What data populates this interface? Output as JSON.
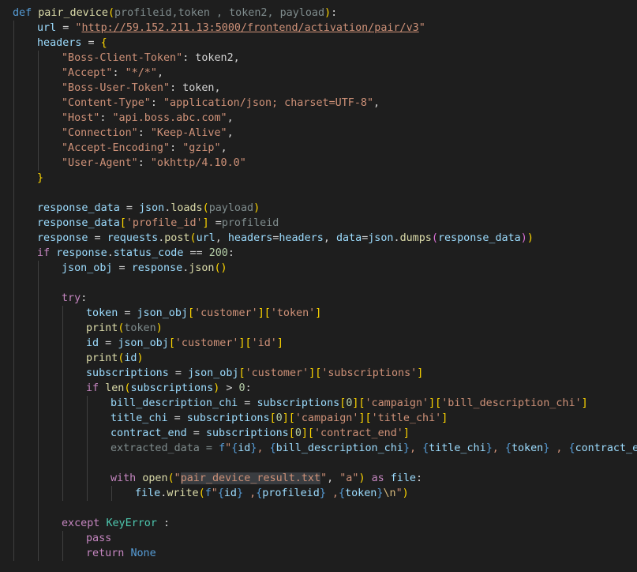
{
  "editor": {
    "language": "python",
    "theme": "dark",
    "colors": {
      "background": "#1e1e1e",
      "keyword": "#569cd6",
      "control": "#c586c0",
      "function": "#dcdcaa",
      "variable": "#9cdcfe",
      "string": "#ce9178",
      "number": "#b5cea8",
      "class": "#4ec9b0",
      "indent_guide": "#404040"
    },
    "lines": [
      {
        "indent": 0,
        "tokens": [
          {
            "t": "def",
            "c": "kw"
          },
          {
            "t": " "
          },
          {
            "t": "pair_device",
            "c": "fn"
          },
          {
            "t": "(",
            "c": "brk"
          },
          {
            "t": "profileid,token , token2, payload",
            "c": "dim"
          },
          {
            "t": ")",
            "c": "brk"
          },
          {
            "t": ":"
          }
        ]
      },
      {
        "indent": 1,
        "tokens": [
          {
            "t": "url",
            "c": "var"
          },
          {
            "t": " = "
          },
          {
            "t": "\"",
            "c": "str"
          },
          {
            "t": "http://59.152.211.13:5000/frontend/activation/pair/v3",
            "c": "url"
          },
          {
            "t": "\"",
            "c": "str"
          }
        ]
      },
      {
        "indent": 1,
        "tokens": [
          {
            "t": "headers",
            "c": "var"
          },
          {
            "t": " = "
          },
          {
            "t": "{",
            "c": "brk"
          }
        ]
      },
      {
        "indent": 2,
        "tokens": [
          {
            "t": "\"Boss-Client-Token\"",
            "c": "str"
          },
          {
            "t": ": token2,"
          }
        ]
      },
      {
        "indent": 2,
        "tokens": [
          {
            "t": "\"Accept\"",
            "c": "str"
          },
          {
            "t": ": "
          },
          {
            "t": "\"*/*\"",
            "c": "str"
          },
          {
            "t": ","
          }
        ]
      },
      {
        "indent": 2,
        "tokens": [
          {
            "t": "\"Boss-User-Token\"",
            "c": "str"
          },
          {
            "t": ": token,"
          }
        ]
      },
      {
        "indent": 2,
        "tokens": [
          {
            "t": "\"Content-Type\"",
            "c": "str"
          },
          {
            "t": ": "
          },
          {
            "t": "\"application/json; charset=UTF-8\"",
            "c": "str"
          },
          {
            "t": ","
          }
        ]
      },
      {
        "indent": 2,
        "tokens": [
          {
            "t": "\"Host\"",
            "c": "str"
          },
          {
            "t": ": "
          },
          {
            "t": "\"api.boss.abc.com\"",
            "c": "str"
          },
          {
            "t": ","
          }
        ]
      },
      {
        "indent": 2,
        "tokens": [
          {
            "t": "\"Connection\"",
            "c": "str"
          },
          {
            "t": ": "
          },
          {
            "t": "\"Keep-Alive\"",
            "c": "str"
          },
          {
            "t": ","
          }
        ]
      },
      {
        "indent": 2,
        "tokens": [
          {
            "t": "\"Accept-Encoding\"",
            "c": "str"
          },
          {
            "t": ": "
          },
          {
            "t": "\"gzip\"",
            "c": "str"
          },
          {
            "t": ","
          }
        ]
      },
      {
        "indent": 2,
        "tokens": [
          {
            "t": "\"User-Agent\"",
            "c": "str"
          },
          {
            "t": ": "
          },
          {
            "t": "\"okhttp/4.10.0\"",
            "c": "str"
          }
        ]
      },
      {
        "indent": 1,
        "tokens": [
          {
            "t": "}",
            "c": "brk"
          }
        ]
      },
      {
        "indent": 0,
        "tokens": []
      },
      {
        "indent": 1,
        "tokens": [
          {
            "t": "response_data",
            "c": "var"
          },
          {
            "t": " = "
          },
          {
            "t": "json",
            "c": "var"
          },
          {
            "t": "."
          },
          {
            "t": "loads",
            "c": "fn"
          },
          {
            "t": "(",
            "c": "brk"
          },
          {
            "t": "payload",
            "c": "dim"
          },
          {
            "t": ")",
            "c": "brk"
          }
        ]
      },
      {
        "indent": 1,
        "tokens": [
          {
            "t": "response_data",
            "c": "var"
          },
          {
            "t": "[",
            "c": "brk"
          },
          {
            "t": "'profile_id'",
            "c": "str"
          },
          {
            "t": "]",
            "c": "brk"
          },
          {
            "t": " ="
          },
          {
            "t": "profileid",
            "c": "dim"
          }
        ]
      },
      {
        "indent": 1,
        "tokens": [
          {
            "t": "response",
            "c": "var"
          },
          {
            "t": " = "
          },
          {
            "t": "requests",
            "c": "var"
          },
          {
            "t": "."
          },
          {
            "t": "post",
            "c": "fn"
          },
          {
            "t": "(",
            "c": "brk"
          },
          {
            "t": "url",
            "c": "var"
          },
          {
            "t": ", "
          },
          {
            "t": "headers",
            "c": "var"
          },
          {
            "t": "="
          },
          {
            "t": "headers",
            "c": "var"
          },
          {
            "t": ", "
          },
          {
            "t": "data",
            "c": "var"
          },
          {
            "t": "="
          },
          {
            "t": "json",
            "c": "var"
          },
          {
            "t": "."
          },
          {
            "t": "dumps",
            "c": "fn"
          },
          {
            "t": "(",
            "c": "par"
          },
          {
            "t": "response_data",
            "c": "var"
          },
          {
            "t": ")",
            "c": "par"
          },
          {
            "t": ")",
            "c": "brk"
          }
        ]
      },
      {
        "indent": 1,
        "tokens": [
          {
            "t": "if",
            "c": "ctl"
          },
          {
            "t": " "
          },
          {
            "t": "response",
            "c": "var"
          },
          {
            "t": "."
          },
          {
            "t": "status_code",
            "c": "var"
          },
          {
            "t": " == "
          },
          {
            "t": "200",
            "c": "num"
          },
          {
            "t": ":"
          }
        ]
      },
      {
        "indent": 2,
        "tokens": [
          {
            "t": "json_obj",
            "c": "var"
          },
          {
            "t": " = "
          },
          {
            "t": "response",
            "c": "var"
          },
          {
            "t": "."
          },
          {
            "t": "json",
            "c": "fn"
          },
          {
            "t": "()",
            "c": "brk"
          }
        ]
      },
      {
        "indent": 0,
        "tokens": []
      },
      {
        "indent": 2,
        "tokens": [
          {
            "t": "try",
            "c": "ctl"
          },
          {
            "t": ":"
          }
        ]
      },
      {
        "indent": 3,
        "tokens": [
          {
            "t": "token",
            "c": "var"
          },
          {
            "t": " = "
          },
          {
            "t": "json_obj",
            "c": "var"
          },
          {
            "t": "[",
            "c": "brk"
          },
          {
            "t": "'customer'",
            "c": "str"
          },
          {
            "t": "][",
            "c": "brk"
          },
          {
            "t": "'token'",
            "c": "str"
          },
          {
            "t": "]",
            "c": "brk"
          }
        ]
      },
      {
        "indent": 3,
        "tokens": [
          {
            "t": "print",
            "c": "fn"
          },
          {
            "t": "(",
            "c": "brk"
          },
          {
            "t": "token",
            "c": "dim"
          },
          {
            "t": ")",
            "c": "brk"
          }
        ]
      },
      {
        "indent": 3,
        "tokens": [
          {
            "t": "id",
            "c": "var"
          },
          {
            "t": " = "
          },
          {
            "t": "json_obj",
            "c": "var"
          },
          {
            "t": "[",
            "c": "brk"
          },
          {
            "t": "'customer'",
            "c": "str"
          },
          {
            "t": "][",
            "c": "brk"
          },
          {
            "t": "'id'",
            "c": "str"
          },
          {
            "t": "]",
            "c": "brk"
          }
        ]
      },
      {
        "indent": 3,
        "tokens": [
          {
            "t": "print",
            "c": "fn"
          },
          {
            "t": "(",
            "c": "brk"
          },
          {
            "t": "id",
            "c": "var"
          },
          {
            "t": ")",
            "c": "brk"
          }
        ]
      },
      {
        "indent": 3,
        "tokens": [
          {
            "t": "subscriptions",
            "c": "var"
          },
          {
            "t": " = "
          },
          {
            "t": "json_obj",
            "c": "var"
          },
          {
            "t": "[",
            "c": "brk"
          },
          {
            "t": "'customer'",
            "c": "str"
          },
          {
            "t": "][",
            "c": "brk"
          },
          {
            "t": "'subscriptions'",
            "c": "str"
          },
          {
            "t": "]",
            "c": "brk"
          }
        ]
      },
      {
        "indent": 3,
        "tokens": [
          {
            "t": "if",
            "c": "ctl"
          },
          {
            "t": " "
          },
          {
            "t": "len",
            "c": "fn"
          },
          {
            "t": "(",
            "c": "brk"
          },
          {
            "t": "subscriptions",
            "c": "var"
          },
          {
            "t": ")",
            "c": "brk"
          },
          {
            "t": " > "
          },
          {
            "t": "0",
            "c": "num"
          },
          {
            "t": ":"
          }
        ]
      },
      {
        "indent": 4,
        "tokens": [
          {
            "t": "bill_description_chi",
            "c": "var"
          },
          {
            "t": " = "
          },
          {
            "t": "subscriptions",
            "c": "var"
          },
          {
            "t": "[",
            "c": "brk"
          },
          {
            "t": "0",
            "c": "num"
          },
          {
            "t": "][",
            "c": "brk"
          },
          {
            "t": "'campaign'",
            "c": "str"
          },
          {
            "t": "][",
            "c": "brk"
          },
          {
            "t": "'bill_description_chi'",
            "c": "str"
          },
          {
            "t": "]",
            "c": "brk"
          }
        ]
      },
      {
        "indent": 4,
        "tokens": [
          {
            "t": "title_chi",
            "c": "var"
          },
          {
            "t": " = "
          },
          {
            "t": "subscriptions",
            "c": "var"
          },
          {
            "t": "[",
            "c": "brk"
          },
          {
            "t": "0",
            "c": "num"
          },
          {
            "t": "][",
            "c": "brk"
          },
          {
            "t": "'campaign'",
            "c": "str"
          },
          {
            "t": "][",
            "c": "brk"
          },
          {
            "t": "'title_chi'",
            "c": "str"
          },
          {
            "t": "]",
            "c": "brk"
          }
        ]
      },
      {
        "indent": 4,
        "tokens": [
          {
            "t": "contract_end",
            "c": "var"
          },
          {
            "t": " = "
          },
          {
            "t": "subscriptions",
            "c": "var"
          },
          {
            "t": "[",
            "c": "brk"
          },
          {
            "t": "0",
            "c": "num"
          },
          {
            "t": "][",
            "c": "brk"
          },
          {
            "t": "'contract_end'",
            "c": "str"
          },
          {
            "t": "]",
            "c": "brk"
          }
        ]
      },
      {
        "indent": 4,
        "tokens": [
          {
            "t": "extracted_data = ",
            "c": "dim"
          },
          {
            "t": "f",
            "c": "kw"
          },
          {
            "t": "\"",
            "c": "str"
          },
          {
            "t": "{",
            "c": "kw"
          },
          {
            "t": "id",
            "c": "var"
          },
          {
            "t": "}",
            "c": "kw"
          },
          {
            "t": ", ",
            "c": "str"
          },
          {
            "t": "{",
            "c": "kw"
          },
          {
            "t": "bill_description_chi",
            "c": "var"
          },
          {
            "t": "}",
            "c": "kw"
          },
          {
            "t": ", ",
            "c": "str"
          },
          {
            "t": "{",
            "c": "kw"
          },
          {
            "t": "title_chi",
            "c": "var"
          },
          {
            "t": "}",
            "c": "kw"
          },
          {
            "t": ", ",
            "c": "str"
          },
          {
            "t": "{",
            "c": "kw"
          },
          {
            "t": "token",
            "c": "var"
          },
          {
            "t": "}",
            "c": "kw"
          },
          {
            "t": " , ",
            "c": "str"
          },
          {
            "t": "{",
            "c": "kw"
          },
          {
            "t": "contract_end",
            "c": "var"
          },
          {
            "t": "}",
            "c": "kw"
          }
        ]
      },
      {
        "indent": 0,
        "tokens": []
      },
      {
        "indent": 4,
        "tokens": [
          {
            "t": "with",
            "c": "ctl"
          },
          {
            "t": " "
          },
          {
            "t": "open",
            "c": "fn"
          },
          {
            "t": "(",
            "c": "brk"
          },
          {
            "t": "\"",
            "c": "str"
          },
          {
            "t": "pair_device_result.txt",
            "c": "str",
            "hl": true
          },
          {
            "t": "\"",
            "c": "str"
          },
          {
            "t": ", "
          },
          {
            "t": "\"a\"",
            "c": "str"
          },
          {
            "t": ")",
            "c": "brk"
          },
          {
            "t": " "
          },
          {
            "t": "as",
            "c": "ctl"
          },
          {
            "t": " "
          },
          {
            "t": "file",
            "c": "var"
          },
          {
            "t": ":"
          }
        ]
      },
      {
        "indent": 5,
        "tokens": [
          {
            "t": "file",
            "c": "var"
          },
          {
            "t": "."
          },
          {
            "t": "write",
            "c": "fn"
          },
          {
            "t": "(",
            "c": "brk"
          },
          {
            "t": "f",
            "c": "kw"
          },
          {
            "t": "\"",
            "c": "str"
          },
          {
            "t": "{",
            "c": "kw"
          },
          {
            "t": "id",
            "c": "var"
          },
          {
            "t": "}",
            "c": "kw"
          },
          {
            "t": " ,",
            "c": "str"
          },
          {
            "t": "{",
            "c": "kw"
          },
          {
            "t": "profileid",
            "c": "var"
          },
          {
            "t": "}",
            "c": "kw"
          },
          {
            "t": " ,",
            "c": "str"
          },
          {
            "t": "{",
            "c": "kw"
          },
          {
            "t": "token",
            "c": "var"
          },
          {
            "t": "}",
            "c": "kw"
          },
          {
            "t": "\\n",
            "c": "esc"
          },
          {
            "t": "\"",
            "c": "str"
          },
          {
            "t": ")",
            "c": "brk"
          }
        ]
      },
      {
        "indent": 0,
        "tokens": []
      },
      {
        "indent": 2,
        "tokens": [
          {
            "t": "except",
            "c": "ctl"
          },
          {
            "t": " "
          },
          {
            "t": "KeyError",
            "c": "cls"
          },
          {
            "t": " :"
          }
        ]
      },
      {
        "indent": 3,
        "tokens": [
          {
            "t": "pass",
            "c": "ctl"
          }
        ]
      },
      {
        "indent": 3,
        "tokens": [
          {
            "t": "return",
            "c": "ctl"
          },
          {
            "t": " "
          },
          {
            "t": "None",
            "c": "kw"
          }
        ]
      }
    ]
  }
}
